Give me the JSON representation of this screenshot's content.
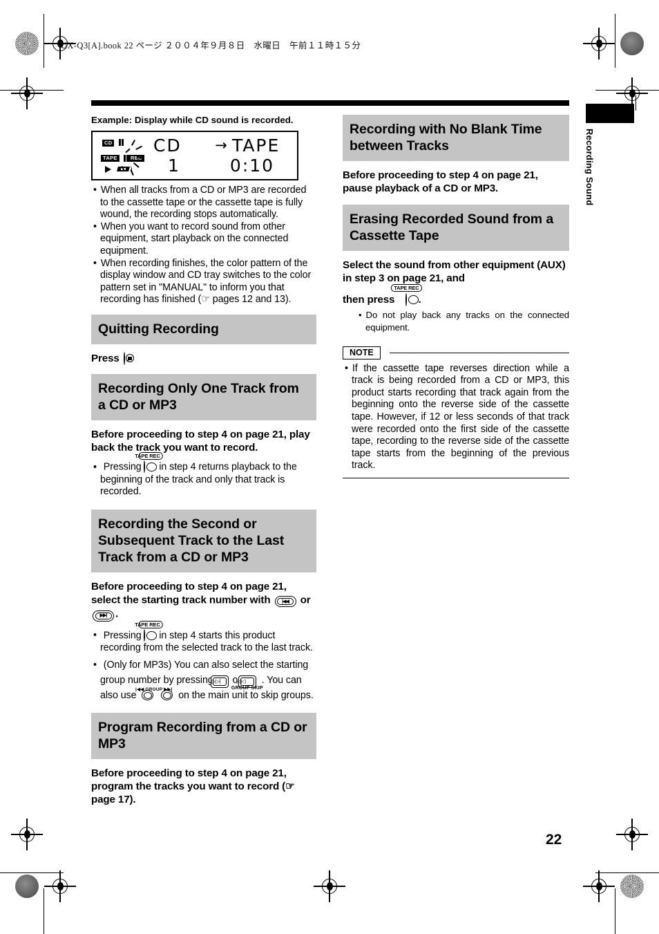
{
  "print_header": "UX-Q3[A].book  22 ページ  ２００４年９月８日　水曜日　午前１１時１５分",
  "side_tab": {
    "label": "Recording Sound"
  },
  "page_number": "22",
  "left_column": {
    "display_example": {
      "caption": "Example: Display while CD sound is recorded.",
      "lcd": {
        "line1_source": "CD",
        "line1_arrow": "→",
        "line1_dest": "TAPE",
        "line2_track": "1",
        "line2_time": "0:10",
        "indicator_cd": "CD",
        "indicator_tape": "TAPE",
        "indicator_rec": "REC"
      },
      "bullets": [
        "When all tracks from a CD or MP3 are recorded to the cassette tape or the cassette tape is fully wound, the recording stops automatically.",
        "When you want to record sound from other equipment, start playback on the connected equipment.",
        "When recording finishes, the color pattern of the display window and CD tray switches to the color pattern set in \"MANUAL\" to inform you that recording has finished (☞ pages 12 and 13)."
      ]
    },
    "sections": [
      {
        "heading": "Quitting Recording",
        "lead_before_icon": "Press",
        "lead_after_icon": "."
      },
      {
        "heading": "Recording Only One Track from a CD or MP3",
        "lead": "Before proceeding to step 4 on page 21, play back the track you want to record.",
        "bullet_part1": "Pressing",
        "bullet_part2": "in step 4 returns playback to the beginning of the track and only that track is recorded.",
        "icon_label": "TAPE REC"
      },
      {
        "heading": "Recording the Second or Subsequent Track to the Last Track from a CD or MP3",
        "lead_part1": "Before proceeding to step 4 on page 21, select the starting track number with",
        "lead_or": "or",
        "lead_end": ".",
        "skip_back_glyph": "|◀◀",
        "skip_fwd_glyph": "▶▶|",
        "bullet1_part1": "Pressing",
        "bullet1_part2": "in step 4 starts this product recording from the selected track to the last track.",
        "bullet2_part1": "(Only for MP3s) You can also select the starting group number by pressing",
        "bullet2_or": "or",
        "bullet2_part2": ". You can also use",
        "bullet2_part3": "on the main unit to skip groups.",
        "group_fwd_glyph": "▷▷|",
        "group_back_glyph": "|◁◁",
        "group_skip_label": "GROUP SKIP",
        "group_pair_label": "|◀◀ GROUP ▶▶|",
        "icon_label": "TAPE REC"
      },
      {
        "heading": "Program Recording from a CD or MP3",
        "lead_part1": "Before proceeding to step 4 on page 21, program the tracks you want to record (",
        "lead_ref": "☞ page 17).",
        "lead_part2": ""
      }
    ]
  },
  "right_column": {
    "sections": [
      {
        "heading": "Recording with No Blank Time between Tracks",
        "lead": "Before proceeding to step 4 on page 21, pause playback of a CD or MP3."
      },
      {
        "heading": "Erasing Recorded Sound from a Cassette Tape",
        "lead_part1": "Select the sound from other equipment (AUX) in step 3 on page 21, and",
        "lead_part2": "then press",
        "lead_part3": ".",
        "icon_label": "TAPE REC",
        "bullets": [
          "Do not play back any tracks on the connected equipment."
        ]
      }
    ],
    "note": {
      "title": "NOTE",
      "bullets": [
        "If the cassette tape reverses direction while a track is being recorded from a CD or MP3, this product starts recording that track again from the beginning onto the reverse side of the cassette tape. However, if 12 or less seconds of that track were recorded onto the first side of the cassette tape, recording to the reverse side of the cassette tape starts from the beginning of the previous track."
      ]
    }
  }
}
